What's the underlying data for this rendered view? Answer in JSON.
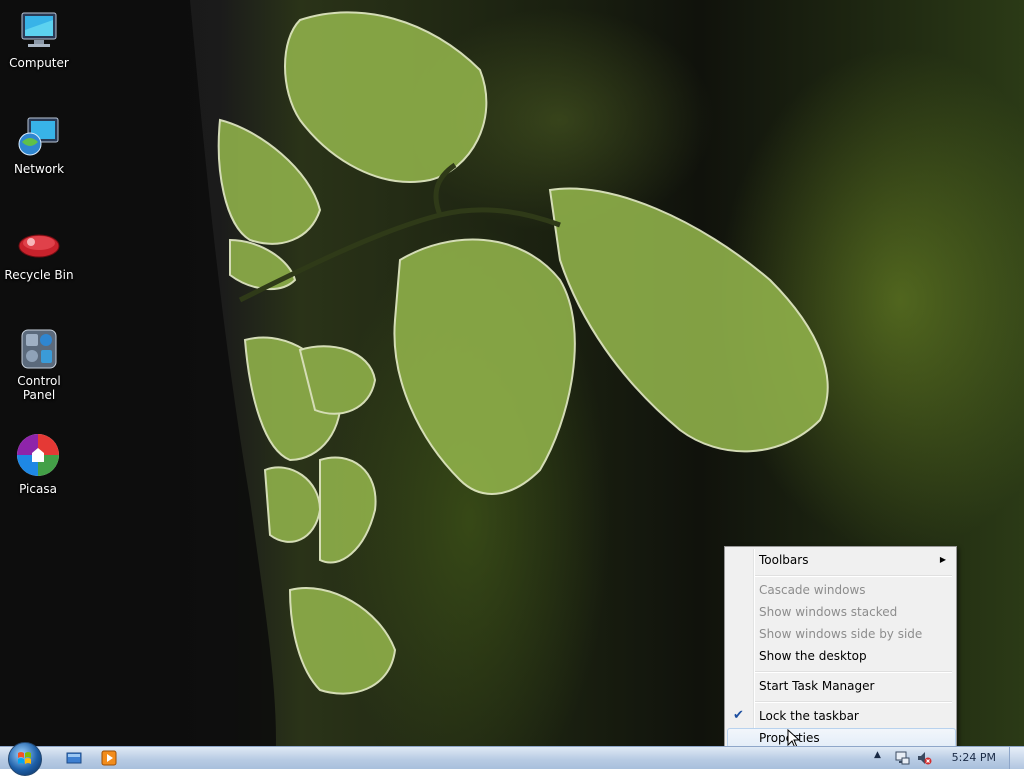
{
  "desktop": {
    "icons": [
      {
        "label": "Computer",
        "icon": "computer-icon"
      },
      {
        "label": "Network",
        "icon": "network-icon"
      },
      {
        "label": "Recycle Bin",
        "icon": "recycle-bin-icon"
      },
      {
        "label": "Control Panel",
        "icon": "control-panel-icon"
      },
      {
        "label": "Picasa",
        "icon": "picasa-icon"
      }
    ]
  },
  "context_menu": {
    "items": [
      {
        "label": "Toolbars",
        "enabled": true,
        "submenu": true
      },
      {
        "label": "Cascade windows",
        "enabled": false
      },
      {
        "label": "Show windows stacked",
        "enabled": false
      },
      {
        "label": "Show windows side by side",
        "enabled": false
      },
      {
        "label": "Show the desktop",
        "enabled": true
      },
      {
        "label": "Start Task Manager",
        "enabled": true
      },
      {
        "label": "Lock the taskbar",
        "enabled": true,
        "checked": true
      },
      {
        "label": "Properties",
        "enabled": true,
        "highlighted": true
      }
    ],
    "submenu_arrow": "▶",
    "checkmark": "✔"
  },
  "taskbar": {
    "start_button": "start-orb-icon",
    "quick_launch": [
      "show-desktop-icon",
      "media-player-icon"
    ],
    "tray_icons": [
      "show-hidden-icons-chevron",
      "network-status-icon",
      "volume-muted-icon"
    ],
    "clock": "5:24 PM"
  },
  "colors": {
    "menu_background": "#f0f0f0",
    "taskbar": "#b9cce4",
    "disabled_text": "#8d8d8d"
  }
}
